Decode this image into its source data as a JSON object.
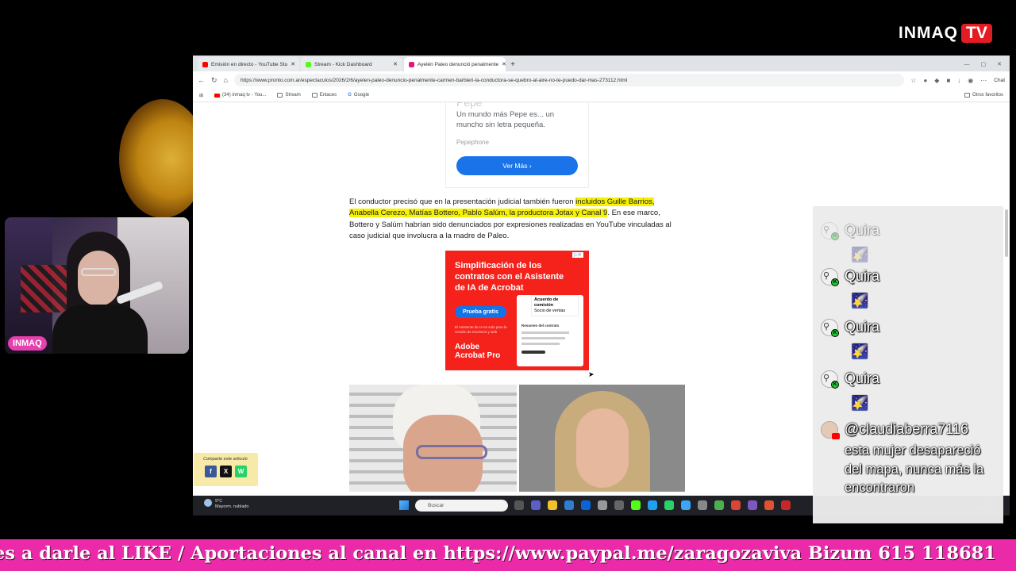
{
  "brand": {
    "name": "INMAQ",
    "tv": "TV",
    "accent": "#e31b23"
  },
  "webcam": {
    "badge": "INMAQ"
  },
  "browser": {
    "tabs": [
      {
        "label": "Emisión en directo - YouTube Stu",
        "favicon": "youtube-icon",
        "color": "#ff0000"
      },
      {
        "label": "Stream - Kick Dashboard",
        "favicon": "kick-icon",
        "color": "#53fc18"
      },
      {
        "label": "Ayelén Paleo denunció penalmente",
        "favicon": "pronto-icon",
        "color": "#e3177e"
      }
    ],
    "url": "https://www.pronto.com.ar/espectaculos/2026/2/6/ayelen-paleo-denuncio-penalmente-carmen-barbieri-la-conductora-se-quebro-al-aire-no-te-puedo-dar-mas-273112.html",
    "chat_label": "Chat",
    "bookmarks": [
      "(34) inmaq tv - You...",
      "Stream",
      "Enlaces",
      "Google"
    ],
    "bookmarks_right": "Otros favoritos"
  },
  "page": {
    "ad_top": {
      "partial": "Pepe",
      "text": "Un mundo más Pepe es... un muncho sin letra pequeña.",
      "advertiser": "Pepephone",
      "button": "Ver Más"
    },
    "article": {
      "before": "El conductor precisó que en la presentación judicial también fueron ",
      "highlight": "incluidos Guille Barrios, Anabella Cerezo, Matías Bottero, Pablo Salúm, la productora Jotax y Canal 9",
      "after": ". En ese marco, Bottero y Salúm habrían sido denunciados por expresiones realizadas en YouTube vinculadas al caso judicial que involucra a la madre de Paleo."
    },
    "adobe_ad": {
      "headline": "Simplificación de los contratos con el Asistente de IA de Acrobat",
      "cta": "Prueba gratis",
      "small": "El Asistente de IA es solo para la versión de escritorio y web",
      "logo_line1": "Adobe",
      "logo_line2": "Acrobat Pro",
      "card_title": "Acuerdo de comisión",
      "card_sub": "Socio de ventas",
      "card_detail": "Resumen del contrato"
    },
    "share": {
      "label": "Comparte este artículo",
      "fb": "f",
      "x": "X",
      "wa": "W"
    }
  },
  "taskbar": {
    "temperature": "9°C",
    "weather": "Mayorm. nublado",
    "search": "Buscar",
    "time": "0:47",
    "date": "03/02/2026"
  },
  "chat": {
    "messages": [
      {
        "user": "Quira",
        "emote": "🌠",
        "faded": true
      },
      {
        "user": "Quira",
        "emote": "🌠",
        "faded": false
      },
      {
        "user": "Quira",
        "emote": "🌠",
        "faded": false
      },
      {
        "user": "Quira",
        "emote": "🌠",
        "faded": false
      }
    ],
    "last": {
      "user": "@claudiaberra7116",
      "text": "esta mujer desapareció del mapa, nunca más la encontraron"
    }
  },
  "ticker": {
    "text": "es a darle al LIKE / Aportaciones al canal en https://www.paypal.me/zaragozaviva Bizum 615 118681",
    "color": "#ea2aa9"
  }
}
